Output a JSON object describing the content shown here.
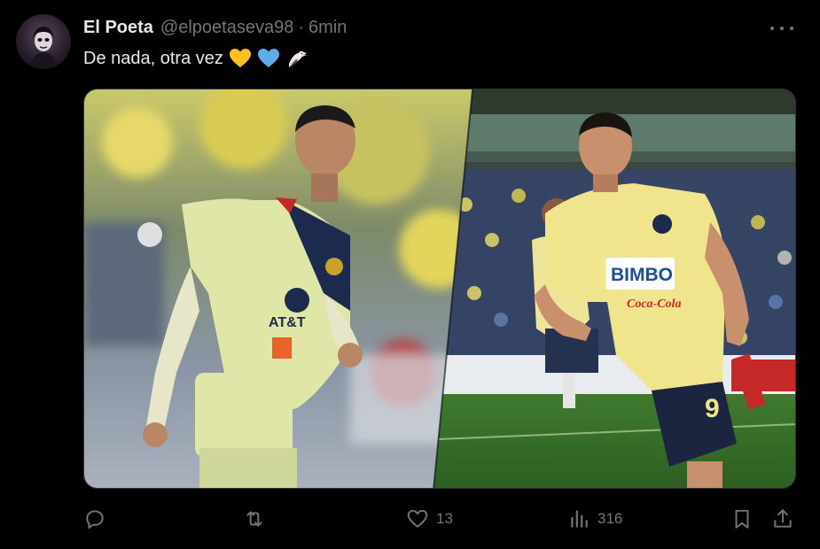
{
  "tweet": {
    "author_name": "El Poeta",
    "author_handle": "@elpoetaseva98",
    "separator": "·",
    "timestamp": "6min",
    "text": "De nada, otra vez",
    "emojis": [
      "yellow-heart",
      "blue-heart",
      "eagle"
    ]
  },
  "media": {
    "left_player": {
      "sponsor_1": "AT&T",
      "jersey_color": "#dfe6a8"
    },
    "right_player": {
      "sponsor_1": "BIMBO",
      "sponsor_2": "Coca-Cola",
      "number": "9",
      "jersey_color": "#f0e58c"
    }
  },
  "actions": {
    "reply_count": "",
    "retweet_count": "",
    "like_count": "13",
    "views_count": "316"
  },
  "colors": {
    "background": "#000000",
    "text_primary": "#e7e9ea",
    "text_secondary": "#71767b"
  }
}
